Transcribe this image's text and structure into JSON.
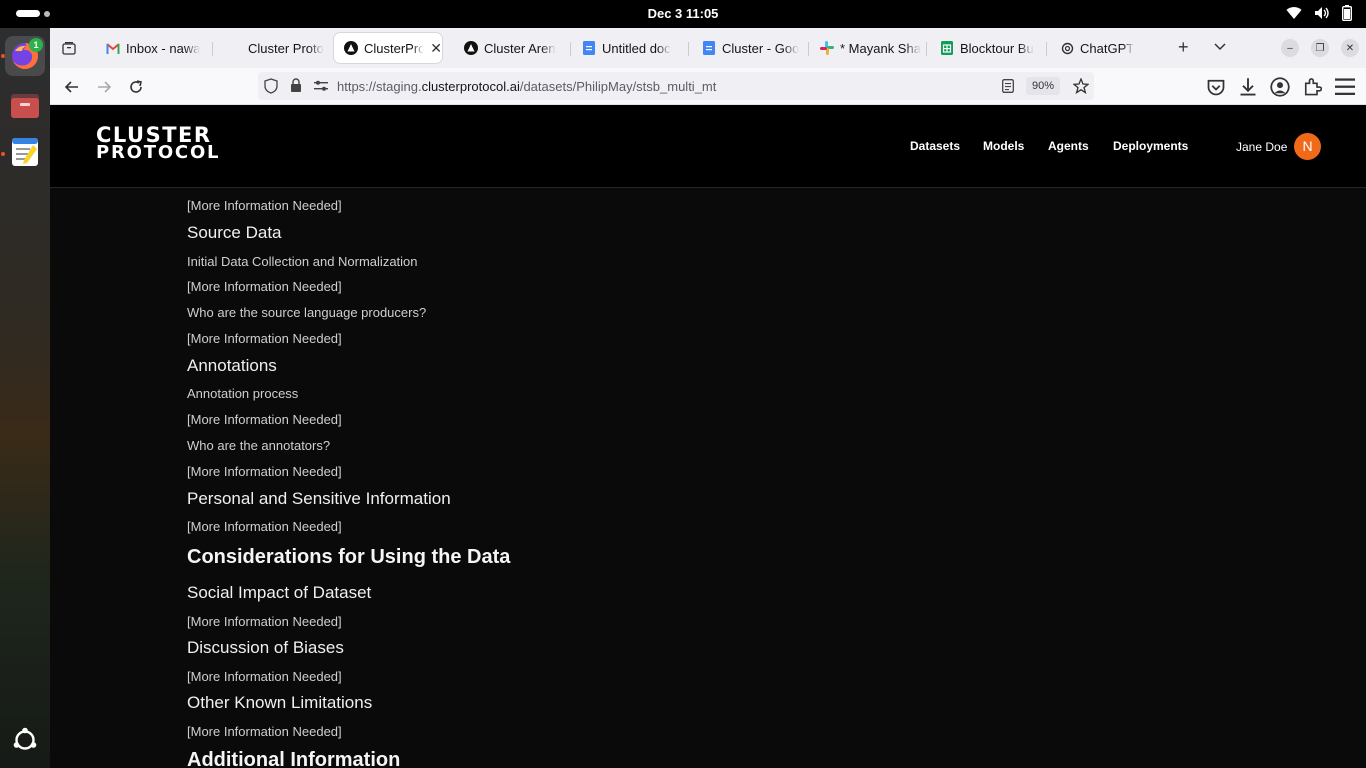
{
  "system": {
    "clock": "Dec 3  11:05"
  },
  "dock": {
    "firefox_badge": "1",
    "apps": [
      "firefox-icon",
      "files-icon",
      "text-editor-icon",
      "ubuntu-grid-icon"
    ]
  },
  "browser": {
    "tabs": [
      {
        "title": "Inbox - nawa",
        "icon": "gmail-icon",
        "active": false
      },
      {
        "title": "Cluster Proto",
        "icon": "cluster-icon",
        "active": false
      },
      {
        "title": "ClusterPro",
        "icon": "cluster-icon",
        "active": true
      },
      {
        "title": "Cluster Aren",
        "icon": "cluster-icon",
        "active": false
      },
      {
        "title": "Untitled doc",
        "icon": "google-docs-icon",
        "active": false
      },
      {
        "title": "Cluster - Goo",
        "icon": "google-docs-icon",
        "active": false
      },
      {
        "title": "* Mayank Sha",
        "icon": "slack-icon",
        "active": false
      },
      {
        "title": "Blocktour Bu",
        "icon": "google-sheets-icon",
        "active": false
      },
      {
        "title": "ChatGPT",
        "icon": "chatgpt-icon",
        "active": false
      }
    ],
    "url": {
      "prefix": "https://staging.",
      "host": "clusterprotocol.ai",
      "path": "/datasets/PhilipMay/stsb_multi_mt"
    },
    "zoom": "90%"
  },
  "site": {
    "logo_line1": "CLUSTER",
    "logo_line2": "PROTOCOL",
    "nav": [
      "Datasets",
      "Models",
      "Agents",
      "Deployments"
    ],
    "user_name": "Jane Doe",
    "avatar_initial": "N"
  },
  "content": [
    {
      "type": "p",
      "text": "[More Information Needed]"
    },
    {
      "type": "h3",
      "text": "Source Data"
    },
    {
      "type": "p",
      "text": "Initial Data Collection and Normalization"
    },
    {
      "type": "p",
      "text": "[More Information Needed]"
    },
    {
      "type": "p",
      "text": "Who are the source language producers?"
    },
    {
      "type": "p",
      "text": "[More Information Needed]"
    },
    {
      "type": "h3",
      "text": "Annotations"
    },
    {
      "type": "p",
      "text": "Annotation process"
    },
    {
      "type": "p",
      "text": "[More Information Needed]"
    },
    {
      "type": "p",
      "text": "Who are the annotators?"
    },
    {
      "type": "p",
      "text": "[More Information Needed]"
    },
    {
      "type": "h3",
      "text": "Personal and Sensitive Information"
    },
    {
      "type": "p",
      "text": "[More Information Needed]"
    },
    {
      "type": "h2",
      "text": "Considerations for Using the Data"
    },
    {
      "type": "h3",
      "text": "Social Impact of Dataset"
    },
    {
      "type": "p",
      "text": "[More Information Needed]"
    },
    {
      "type": "h3",
      "text": "Discussion of Biases"
    },
    {
      "type": "p",
      "text": "[More Information Needed]"
    },
    {
      "type": "h3",
      "text": "Other Known Limitations"
    },
    {
      "type": "p",
      "text": "[More Information Needed]"
    },
    {
      "type": "h2",
      "text": "Additional Information"
    }
  ]
}
